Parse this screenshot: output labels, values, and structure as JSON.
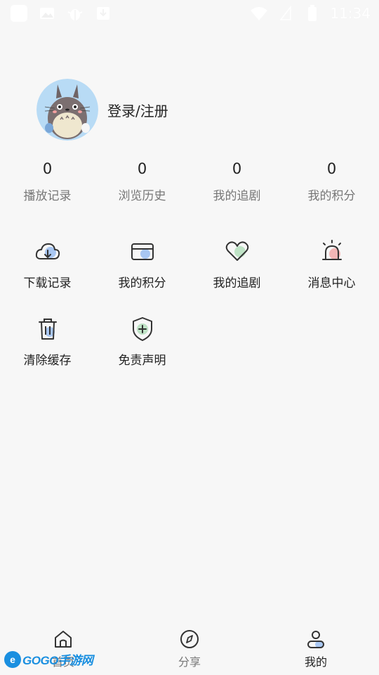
{
  "status_bar": {
    "time": "11:34",
    "icons": [
      "app-icon",
      "image-icon",
      "bug-icon",
      "download-notify-icon",
      "wifi-icon",
      "signal-icon",
      "battery-icon"
    ]
  },
  "profile": {
    "login_label": "登录/注册",
    "avatar": "totoro-avatar"
  },
  "stats": [
    {
      "value": "0",
      "label": "播放记录"
    },
    {
      "value": "0",
      "label": "浏览历史"
    },
    {
      "value": "0",
      "label": "我的追剧"
    },
    {
      "value": "0",
      "label": "我的积分"
    }
  ],
  "menu": [
    {
      "label": "下载记录",
      "icon": "cloud-download-icon"
    },
    {
      "label": "我的积分",
      "icon": "card-icon"
    },
    {
      "label": "我的追剧",
      "icon": "heart-icon"
    },
    {
      "label": "消息中心",
      "icon": "alarm-bell-icon"
    },
    {
      "label": "清除缓存",
      "icon": "trash-icon"
    },
    {
      "label": "免责声明",
      "icon": "shield-plus-icon"
    }
  ],
  "tabs": [
    {
      "label": "首页",
      "icon": "home-icon"
    },
    {
      "label": "分享",
      "icon": "compass-icon"
    },
    {
      "label": "我的",
      "icon": "user-icon",
      "active": true
    }
  ],
  "watermark": {
    "text": "GOGO手游网",
    "url": "WWW.GOGGO.CN"
  },
  "colors": {
    "accent_blue": "#a9c7f2",
    "accent_green": "#bfe3c6",
    "accent_red": "#f4b6b6",
    "background": "#f7f7f7"
  }
}
